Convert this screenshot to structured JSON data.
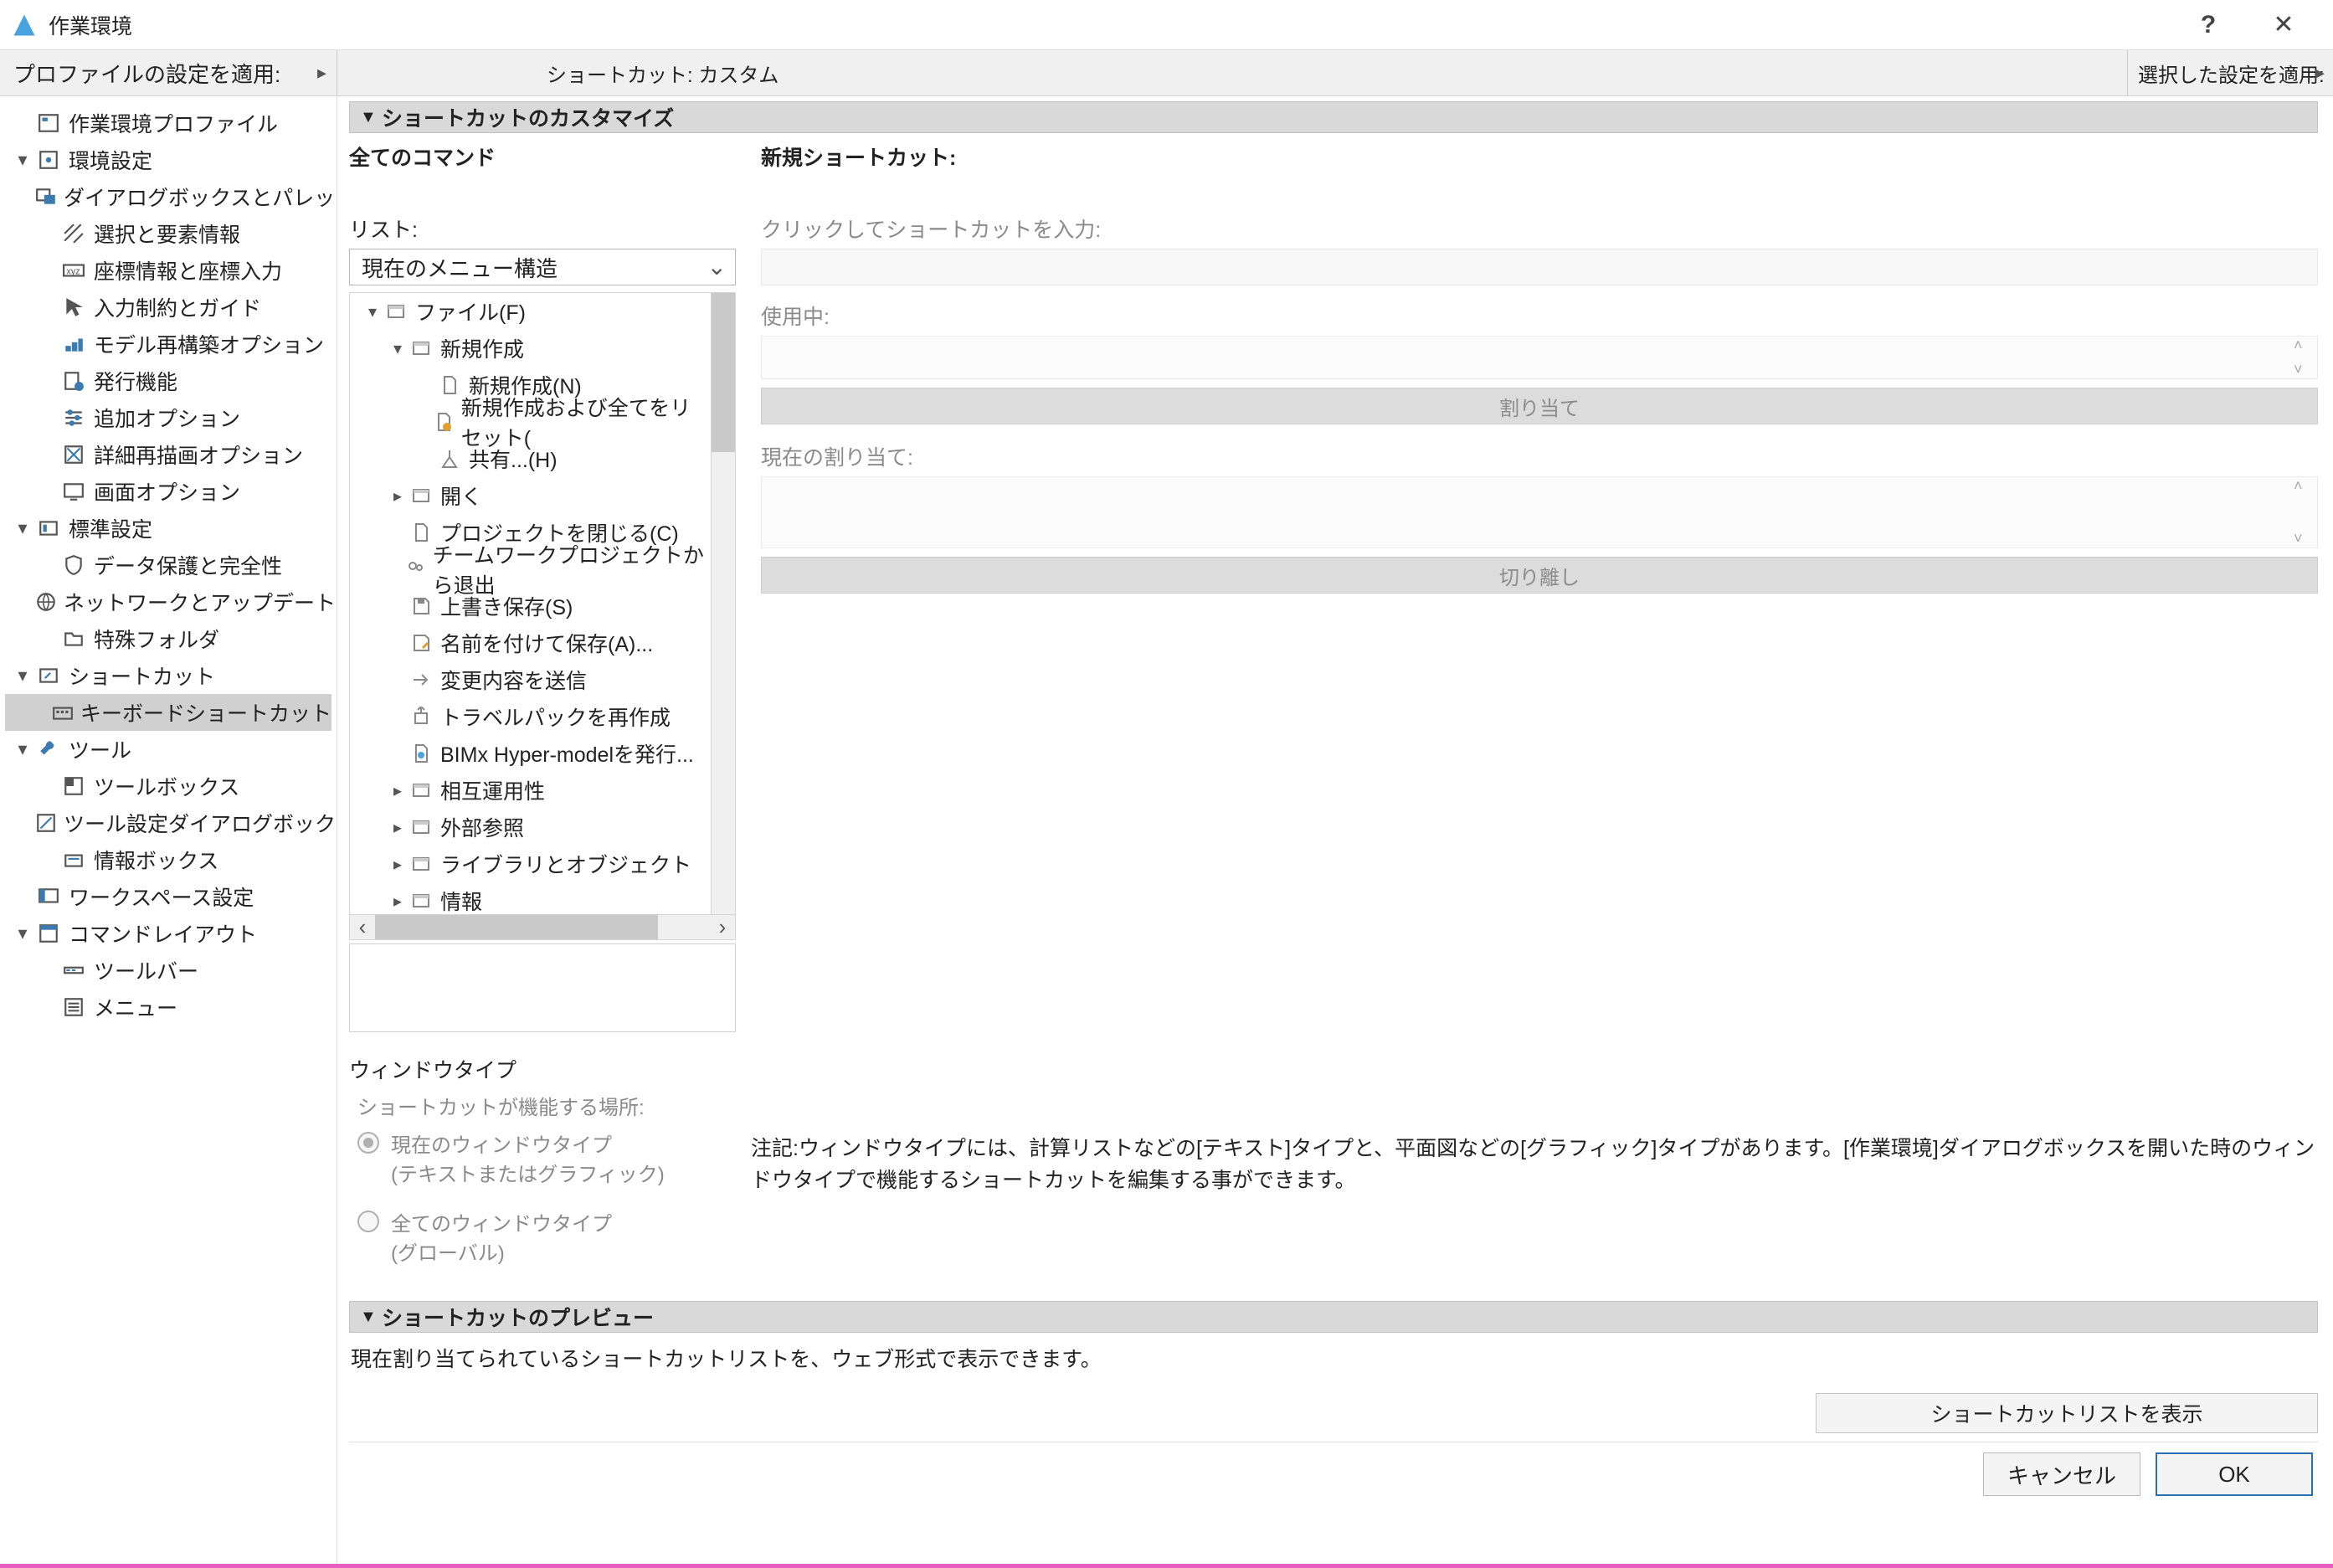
{
  "titlebar": {
    "title": "作業環境",
    "help": "?",
    "close": "✕"
  },
  "secondbar": {
    "profile_apply": "プロファイルの設定を適用:",
    "center_title": "ショートカット: カスタム",
    "selected_apply": "選択した設定を適用:"
  },
  "left_tree": {
    "items": [
      {
        "level": 1,
        "caret": "",
        "label": "作業環境プロファイル",
        "icon": "profile"
      },
      {
        "level": 1,
        "caret": "▾",
        "label": "環境設定",
        "icon": "settings"
      },
      {
        "level": 2,
        "caret": "",
        "label": "ダイアログボックスとパレット",
        "icon": "dialog"
      },
      {
        "level": 2,
        "caret": "",
        "label": "選択と要素情報",
        "icon": "hatch"
      },
      {
        "level": 2,
        "caret": "",
        "label": "座標情報と座標入力",
        "icon": "xyz"
      },
      {
        "level": 2,
        "caret": "",
        "label": "入力制約とガイド",
        "icon": "cursor"
      },
      {
        "level": 2,
        "caret": "",
        "label": "モデル再構築オプション",
        "icon": "rebuild"
      },
      {
        "level": 2,
        "caret": "",
        "label": "発行機能",
        "icon": "publish"
      },
      {
        "level": 2,
        "caret": "",
        "label": "追加オプション",
        "icon": "sliders"
      },
      {
        "level": 2,
        "caret": "",
        "label": "詳細再描画オプション",
        "icon": "redraw"
      },
      {
        "level": 2,
        "caret": "",
        "label": "画面オプション",
        "icon": "monitor"
      },
      {
        "level": 1,
        "caret": "▾",
        "label": "標準設定",
        "icon": "standard"
      },
      {
        "level": 2,
        "caret": "",
        "label": "データ保護と完全性",
        "icon": "shield"
      },
      {
        "level": 2,
        "caret": "",
        "label": "ネットワークとアップデート",
        "icon": "globe"
      },
      {
        "level": 2,
        "caret": "",
        "label": "特殊フォルダ",
        "icon": "folder"
      },
      {
        "level": 1,
        "caret": "▾",
        "label": "ショートカット",
        "icon": "shortcut"
      },
      {
        "level": 2,
        "caret": "",
        "label": "キーボードショートカット",
        "icon": "keyboard",
        "selected": true
      },
      {
        "level": 1,
        "caret": "▾",
        "label": "ツール",
        "icon": "tools"
      },
      {
        "level": 2,
        "caret": "",
        "label": "ツールボックス",
        "icon": "toolbox"
      },
      {
        "level": 2,
        "caret": "",
        "label": "ツール設定ダイアログボックス",
        "icon": "tooldlg"
      },
      {
        "level": 2,
        "caret": "",
        "label": "情報ボックス",
        "icon": "infobox"
      },
      {
        "level": 1,
        "caret": "",
        "label": "ワークスペース設定",
        "icon": "workspace"
      },
      {
        "level": 1,
        "caret": "▾",
        "label": "コマンドレイアウト",
        "icon": "cmdlayout"
      },
      {
        "level": 2,
        "caret": "",
        "label": "ツールバー",
        "icon": "toolbar"
      },
      {
        "level": 2,
        "caret": "",
        "label": "メニュー",
        "icon": "menu"
      }
    ]
  },
  "section_customize": "ショートカットのカスタマイズ",
  "all_commands": "全てのコマンド",
  "list_label": "リスト:",
  "list_value": "現在のメニュー構造",
  "cmd_tree": [
    {
      "depth": 1,
      "caret": "▾",
      "icon": "folder2",
      "label": "ファイル(F)"
    },
    {
      "depth": 2,
      "caret": "▾",
      "icon": "folder2",
      "label": "新規作成"
    },
    {
      "depth": 3,
      "caret": "",
      "icon": "page",
      "label": "新規作成(N)"
    },
    {
      "depth": 3,
      "caret": "",
      "icon": "pagereset",
      "label": "新規作成および全てをリセット("
    },
    {
      "depth": 3,
      "caret": "",
      "icon": "share",
      "label": "共有...(H)"
    },
    {
      "depth": 2,
      "caret": "▸",
      "icon": "folder2",
      "label": "開く"
    },
    {
      "depth": 2,
      "caret": "",
      "icon": "page",
      "label": "プロジェクトを閉じる(C)"
    },
    {
      "depth": 2,
      "caret": "",
      "icon": "team",
      "label": "チームワークプロジェクトから退出"
    },
    {
      "depth": 2,
      "caret": "",
      "icon": "save",
      "label": "上書き保存(S)"
    },
    {
      "depth": 2,
      "caret": "",
      "icon": "saveas",
      "label": "名前を付けて保存(A)..."
    },
    {
      "depth": 2,
      "caret": "",
      "icon": "send",
      "label": "変更内容を送信"
    },
    {
      "depth": 2,
      "caret": "",
      "icon": "travel",
      "label": "トラベルパックを再作成"
    },
    {
      "depth": 2,
      "caret": "",
      "icon": "bimx",
      "label": "BIMx Hyper-modelを発行..."
    },
    {
      "depth": 2,
      "caret": "▸",
      "icon": "folder2",
      "label": "相互運用性"
    },
    {
      "depth": 2,
      "caret": "▸",
      "icon": "folder2",
      "label": "外部参照"
    },
    {
      "depth": 2,
      "caret": "▸",
      "icon": "folder2",
      "label": "ライブラリとオブジェクト"
    },
    {
      "depth": 2,
      "caret": "▸",
      "icon": "folder2",
      "label": "情報"
    }
  ],
  "new_shortcut": "新規ショートカット:",
  "click_to_enter": "クリックしてショートカットを入力:",
  "in_use": "使用中:",
  "assign_btn": "割り当て",
  "current_assign": "現在の割り当て:",
  "detach_btn": "切り離し",
  "window_type": {
    "title": "ウィンドウタイプ",
    "where": "ショートカットが機能する場所:",
    "opt1a": "現在のウィンドウタイプ",
    "opt1b": "(テキストまたはグラフィック)",
    "opt2a": "全てのウィンドウタイプ",
    "opt2b": "(グローバル)",
    "note": "注記:ウィンドウタイプには、計算リストなどの[テキスト]タイプと、平面図などの[グラフィック]タイプがあります。[作業環境]ダイアログボックスを開いた時のウィンドウタイプで機能するショートカットを編集する事ができます。"
  },
  "section_preview": "ショートカットのプレビュー",
  "preview_text": "現在割り当てられているショートカットリストを、ウェブ形式で表示できます。",
  "show_list_btn": "ショートカットリストを表示",
  "footer": {
    "cancel": "キャンセル",
    "ok": "OK"
  }
}
